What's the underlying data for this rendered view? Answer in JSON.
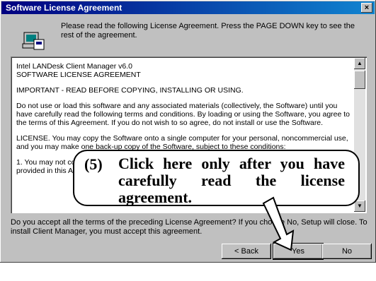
{
  "window": {
    "title": "Software License Agreement",
    "close_glyph": "×"
  },
  "intro": {
    "icon": "setup-icon",
    "text": "Please read the following License Agreement. Press the PAGE DOWN key to see the rest of the agreement."
  },
  "license": {
    "lines": [
      "Intel LANDesk Client Manager v6.0",
      "SOFTWARE LICENSE AGREEMENT",
      "IMPORTANT - READ BEFORE COPYING, INSTALLING OR USING.",
      "Do not use or load this software and any associated materials (collectively, the Software) until you have carefully read the following terms and conditions. By loading or using the Software, you agree to the terms of this Agreement. If you do not wish to so agree, do not install or use the Software.",
      "LICENSE. You may copy the Software onto a single computer for your personal, noncommercial use, and you may make one back-up copy of the Software, subject to these conditions:",
      "1. You may not copy, modify, rent, sell, distribute or transfer any part of the Software except as provided in this Agreement."
    ]
  },
  "question": {
    "text": "Do you accept all the terms of the preceding License Agreement? If you choose No, Setup will close. To install Client Manager, you must accept this agreement."
  },
  "buttons": {
    "back": "< Back",
    "yes": "Yes",
    "no": "No"
  },
  "callout": {
    "number": "(5)",
    "text": "Click here only after you have carefully read the license agreement."
  }
}
